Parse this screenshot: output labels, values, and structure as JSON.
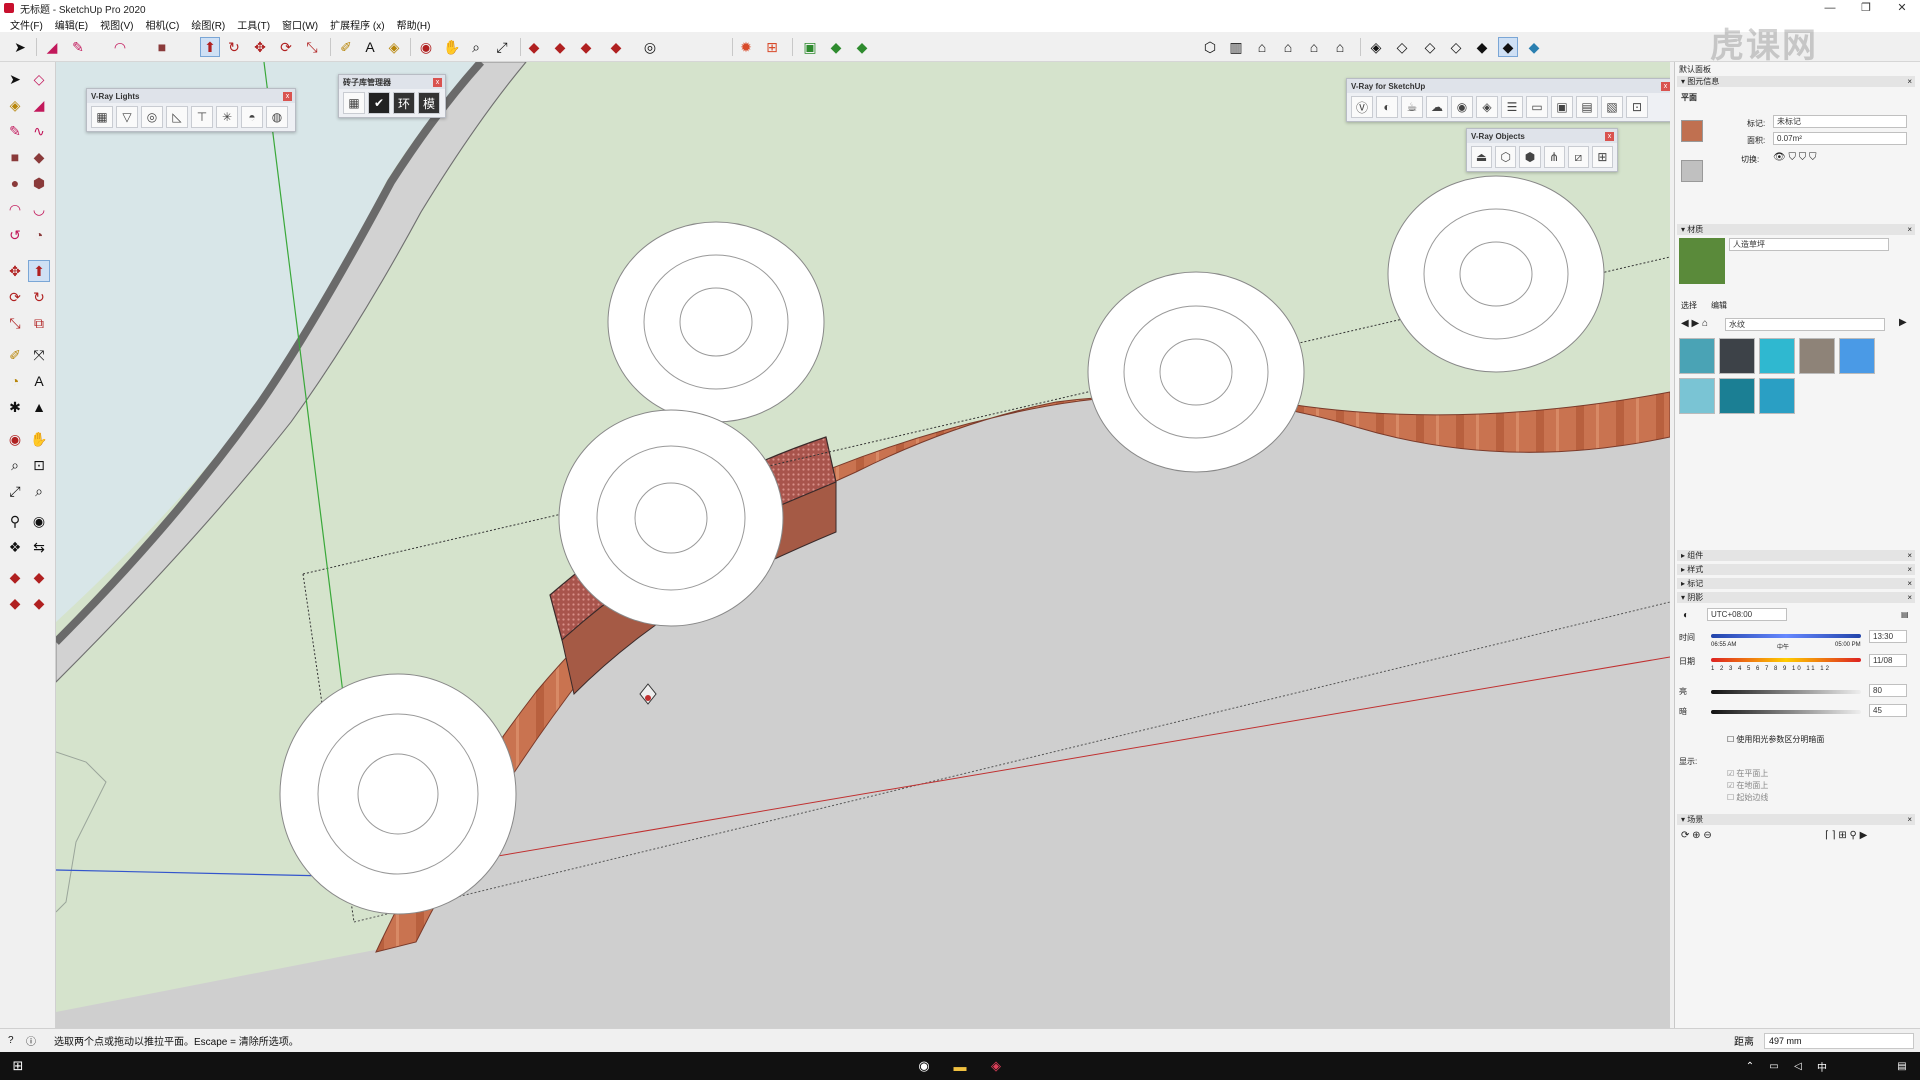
{
  "window": {
    "title": "无标题 - SketchUp Pro 2020",
    "controls": [
      "—",
      "❐",
      "✕"
    ]
  },
  "menu": [
    "文件(F)",
    "编辑(E)",
    "视图(V)",
    "相机(C)",
    "绘图(R)",
    "工具(T)",
    "窗口(W)",
    "扩展程序 (x)",
    "帮助(H)"
  ],
  "palettes": {
    "vray_lights": {
      "title": "V-Ray Lights",
      "icons": [
        "rect-light-icon",
        "spot-light-icon",
        "sphere-light-icon",
        "ies-light-icon",
        "omni-light-icon",
        "dome-light-icon",
        "mesh-light-icon",
        "light-gen-icon"
      ]
    },
    "brick_manager": {
      "title": "砖子库管理器",
      "icons": [
        "table-icon",
        "check-icon",
        "ring-icon",
        "model-icon"
      ],
      "labels": [
        "",
        "",
        "环",
        "模"
      ]
    },
    "vray_sketchup": {
      "title": "V-Ray for SketchUp"
    },
    "vray_objects": {
      "title": "V-Ray Objects"
    }
  },
  "tray": {
    "panel_title": "默认面板",
    "entity_info": {
      "header": "图元信息",
      "type": "平面",
      "tag_label": "标记:",
      "tag_value": "未标记",
      "area_label": "面积:",
      "area_value": "0.07m²",
      "toggle_label": "切换:"
    },
    "materials": {
      "header": "材质",
      "name": "人造草坪",
      "tab_select": "选择",
      "tab_edit": "编辑",
      "collection": "水纹",
      "swatches": [
        "#4aa3b5",
        "#3d4248",
        "#2fb8d0",
        "#8e8378",
        "#4a9ae6",
        "#7ac4d4",
        "#1b7f94",
        "#2a9fc4"
      ]
    },
    "collapsed": [
      "组件",
      "样式",
      "标记"
    ],
    "shadows": {
      "header": "阴影",
      "timezone": "UTC+08:00",
      "time_label": "时间",
      "time_start": "06:55 AM",
      "time_noon": "中午",
      "time_end": "05:00 PM",
      "time_value": "13:30",
      "date_label": "日期",
      "months": [
        "1",
        "2",
        "3",
        "4",
        "5",
        "6",
        "7",
        "8",
        "9",
        "10",
        "11",
        "12"
      ],
      "date_value": "11/08",
      "light_label": "亮",
      "light_value": "80",
      "dark_label": "暗",
      "dark_value": "45",
      "use_sun": "使用阳光参数区分明暗面",
      "display_label": "显示:",
      "on_face": "在平面上",
      "on_ground": "在地面上",
      "from_edges": "起始边线"
    },
    "scenes": {
      "header": "场景"
    }
  },
  "status": {
    "hint": "选取两个点或拖动以推拉平面。Escape = 清除所选项。",
    "distance_label": "距离",
    "distance_value": "497 mm"
  },
  "watermark": "虎课网",
  "colors": {
    "grass": "#d5e3cc",
    "water": "#d8e6e8",
    "path": "#d2d2d2",
    "brick": "#c8704e",
    "selected": "#9c4a44"
  }
}
